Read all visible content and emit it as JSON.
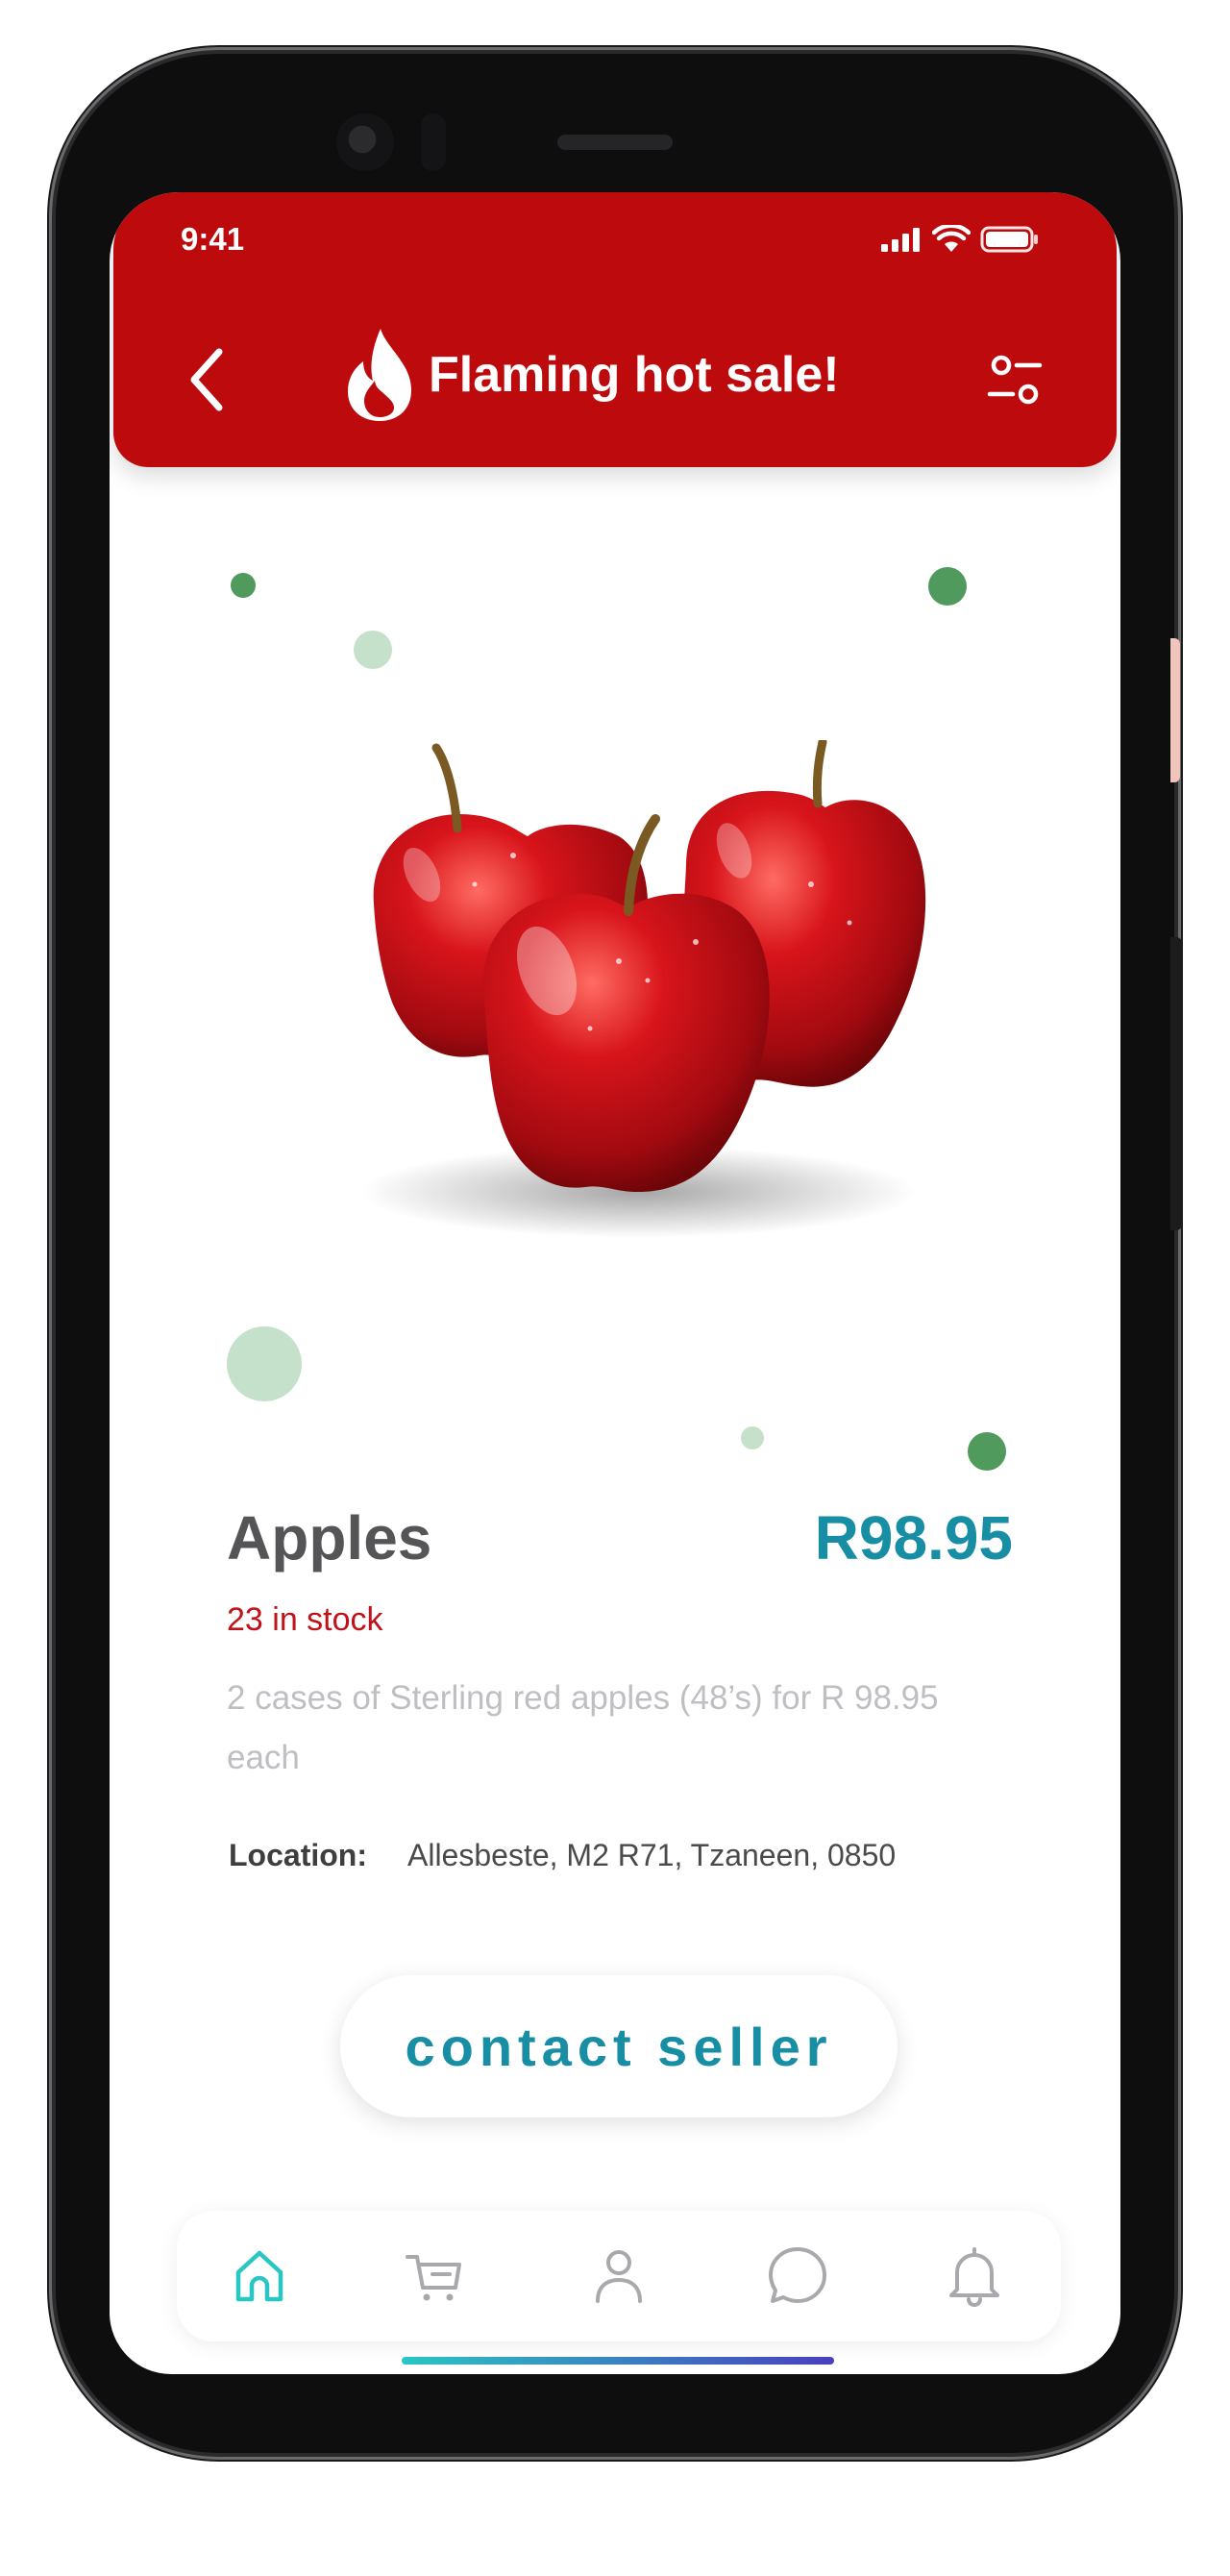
{
  "status_bar": {
    "time": "9:41"
  },
  "header": {
    "title": "Flaming hot sale!",
    "back_icon": "chevron-left-icon",
    "title_icon": "flame-icon",
    "filter_icon": "sliders-icon",
    "background": "#bd0b0d"
  },
  "product": {
    "name": "Apples",
    "price": "R98.95",
    "stock": "23 in stock",
    "description": "2 cases of Sterling red apples (48’s) for R 98.95 each",
    "location_label": "Location:",
    "location_value": "Allesbeste, M2 R71, Tzaneen, 0850",
    "image": "red-apples-photo"
  },
  "cta": {
    "label": "contact seller",
    "color": "#178ea4"
  },
  "bottom_nav": {
    "items": [
      {
        "name": "home",
        "icon": "home-icon",
        "active": true
      },
      {
        "name": "cart",
        "icon": "cart-icon",
        "active": false
      },
      {
        "name": "profile",
        "icon": "user-icon",
        "active": false
      },
      {
        "name": "chat",
        "icon": "chat-icon",
        "active": false
      },
      {
        "name": "notifications",
        "icon": "bell-icon",
        "active": false
      }
    ],
    "active_color": "#29c6c3",
    "inactive_color": "#a9a9ad"
  },
  "colors": {
    "accent": "#178ea4",
    "brand_red": "#bd0b0d",
    "decor_green": "#4f9a5c"
  }
}
